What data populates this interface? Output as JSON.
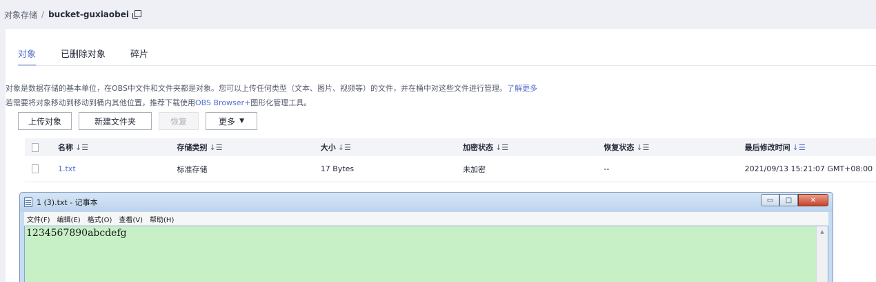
{
  "breadcrumb": {
    "root": "对象存储",
    "separator": "/",
    "bucket": "bucket-guxiaobei"
  },
  "tabs": [
    {
      "label": "对象",
      "active": true
    },
    {
      "label": "已删除对象",
      "active": false
    },
    {
      "label": "碎片",
      "active": false
    }
  ],
  "description": {
    "line1": "对象是数据存储的基本单位，在OBS中文件和文件夹都是对象。您可以上传任何类型（文本、图片、视频等）的文件，并在桶中对这些文件进行管理。",
    "line1_link": "了解更多",
    "line2_pre": "若需要将对象移动到移动到桶内其他位置，推荐下载使用",
    "line2_link": "OBS Browser+",
    "line2_post": "图形化管理工具。"
  },
  "toolbar": {
    "upload": "上传对象",
    "new_folder": "新建文件夹",
    "restore": "恢复",
    "more": "更多",
    "more_caret": "▼"
  },
  "table": {
    "headers": {
      "name": "名称",
      "storage_class": "存储类别",
      "size": "大小",
      "encryption": "加密状态",
      "restore_status": "恢复状态",
      "modified": "最后修改时间",
      "sort_glyph": "↓☰"
    },
    "rows": [
      {
        "name": "1.txt",
        "storage_class": "标准存储",
        "size": "17 Bytes",
        "encryption": "未加密",
        "restore_status": "--",
        "modified": "2021/09/13 15:21:07 GMT+08:00"
      }
    ]
  },
  "notepad": {
    "title": "1 (3).txt - 记事本",
    "menu": [
      "文件(F)",
      "编辑(E)",
      "格式(O)",
      "查看(V)",
      "帮助(H)"
    ],
    "content": "1234567890abcdefg",
    "controls": {
      "minimize": "▭",
      "maximize": "□",
      "close": "✕"
    },
    "scroll_up": "▲",
    "colors": {
      "edit_background": "#c7f0c7",
      "title_gradient_top": "#d6e6f7"
    }
  },
  "colors": {
    "accent": "#526ecc",
    "panel": "#ffffff",
    "page_background": "#eef0f5"
  }
}
